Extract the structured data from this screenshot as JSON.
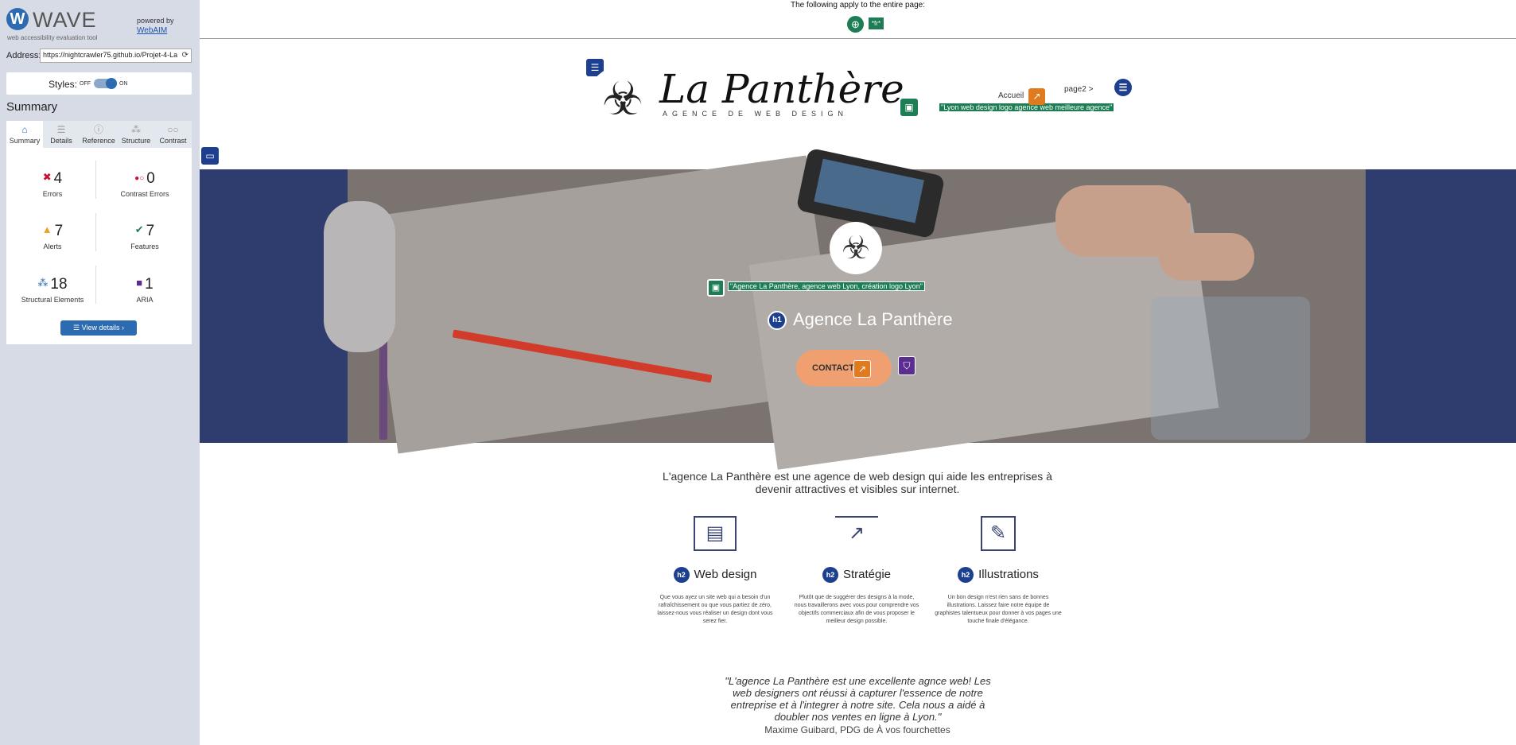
{
  "wave": {
    "brand": "WAVE",
    "tagline": "web accessibility evaluation tool",
    "powered_by": "powered by",
    "webaim": "WebAIM",
    "address_label": "Address:",
    "address_value": "https://nightcrawler75.github.io/Projet-4-La",
    "styles_label": "Styles:",
    "styles_off": "OFF",
    "styles_on": "ON",
    "summary_title": "Summary",
    "tabs": [
      {
        "label": "Summary"
      },
      {
        "label": "Details"
      },
      {
        "label": "Reference"
      },
      {
        "label": "Structure"
      },
      {
        "label": "Contrast"
      }
    ],
    "stats": {
      "errors": {
        "value": "4",
        "label": "Errors"
      },
      "contrast": {
        "value": "0",
        "label": "Contrast Errors"
      },
      "alerts": {
        "value": "7",
        "label": "Alerts"
      },
      "features": {
        "value": "7",
        "label": "Features"
      },
      "structural": {
        "value": "18",
        "label": "Structural Elements"
      },
      "aria": {
        "value": "1",
        "label": "ARIA"
      }
    },
    "view_details": "View details ›",
    "colors": {
      "accent": "#2d6bb0",
      "error": "#c8102e",
      "alert": "#f0a020",
      "feature": "#1d7d55",
      "aria": "#5a2d91"
    }
  },
  "topbar": {
    "text": "The following apply to the entire page:",
    "lang_badge": "fr"
  },
  "site": {
    "brand_name": "La Panthère",
    "brand_sub": "AGENCE DE WEB DESIGN",
    "nav_accueil": "Accueil",
    "nav_page2": "page2 >",
    "logo_alt": "\"Lyon web design logo agence web meilleure agence\"",
    "hero_alt": "\"Agence La Panthère, agence web Lyon, création logo Lyon\"",
    "hero_title": "Agence La Panthère",
    "contact": "CONTACT",
    "intro": "L'agence La Panthère est une agence de web design qui aide les entreprises à devenir attractives et visibles sur internet.",
    "services": [
      {
        "title": "Web design",
        "text": "Que vous ayez un site web qui a besoin d'un rafraîchissement ou que vous partiez de zéro, laissez-nous vous réaliser un design dont vous serez fier."
      },
      {
        "title": "Stratégie",
        "text": "Plutôt que de suggérer des designs à la mode, nous travaillerons avec vous pour comprendre vos objectifs commerciaux afin de vous proposer le meilleur design possible."
      },
      {
        "title": "Illustrations",
        "text": "Un bon design n'est rien sans de bonnes illustrations. Laissez faire notre équipe de graphistes talentueux pour donner à vos pages une touche finale d'élégance."
      }
    ],
    "quote": "\"L'agence La Panthère est une excellente agnce web! Les web designers ont réussi à capturer l'essence de notre entreprise et à l'integrer à notre site. Cela nous a aidé à doubler nos ventes en ligne à Lyon.\"",
    "quote_author": "Maxime Guibard, PDG de À vos fourchettes",
    "badges": {
      "h1": "h1",
      "h2": "h2"
    }
  }
}
